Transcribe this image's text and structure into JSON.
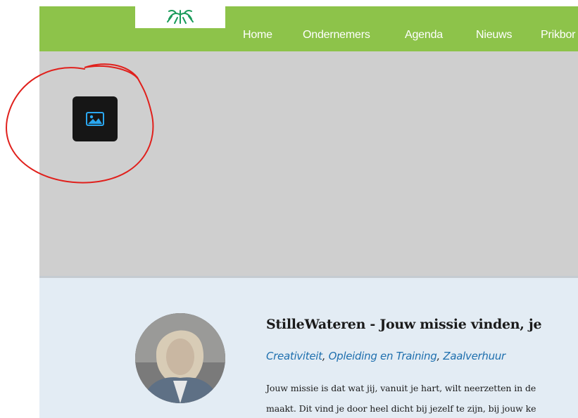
{
  "nav": {
    "items": [
      "Home",
      "Ondernemers",
      "Agenda",
      "Nieuws",
      "Prikbor"
    ]
  },
  "post": {
    "title": "StilleWateren - Jouw missie vinden, je",
    "categories": [
      "Creativiteit",
      "Opleiding en Training",
      "Zaalverhuur"
    ],
    "separator": ", ",
    "excerpt": [
      "Jouw missie is dat wat jij, vanuit je hart, wilt neerzetten in de",
      "maakt. Dit vind je door heel dicht bij jezelf te zijn, bij jouw ke"
    ]
  },
  "icons": {
    "logo": "tree-roots-logo-icon",
    "placeholder": "image-icon"
  },
  "colors": {
    "nav_background": "#8dc34a",
    "banner_background": "#cfcfcf",
    "content_background": "#e3ecf4",
    "link": "#1e6fae",
    "placeholder_icon": "#2aa7f0",
    "annotation": "#e0201c"
  }
}
